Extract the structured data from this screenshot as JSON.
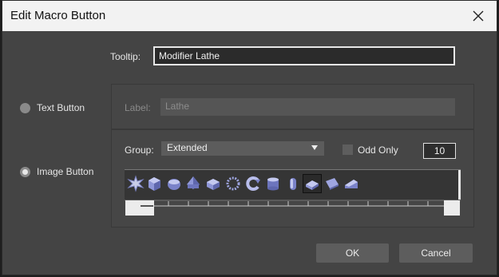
{
  "dialog": {
    "title": "Edit Macro Button"
  },
  "tooltip": {
    "label": "Tooltip:",
    "value": "Modifier Lathe"
  },
  "options": {
    "text_button": "Text Button",
    "image_button": "Image Button",
    "selected": "Image Button"
  },
  "label_field": {
    "label": "Label:",
    "value": "Lathe"
  },
  "group": {
    "label": "Group:",
    "selected": "Extended"
  },
  "odd_only": {
    "label": "Odd Only",
    "checked": false
  },
  "count": "10",
  "icons": [
    "burst-icon",
    "cube-icon",
    "sphere-icon",
    "pyramid-icon",
    "box-icon",
    "gear-ring-icon",
    "swirl-icon",
    "cylinder-icon",
    "capsule-icon",
    "lathe-icon",
    "wedge-icon",
    "prism-icon"
  ],
  "selected_icon": "lathe-icon",
  "buttons": {
    "ok": "OK",
    "cancel": "Cancel"
  }
}
